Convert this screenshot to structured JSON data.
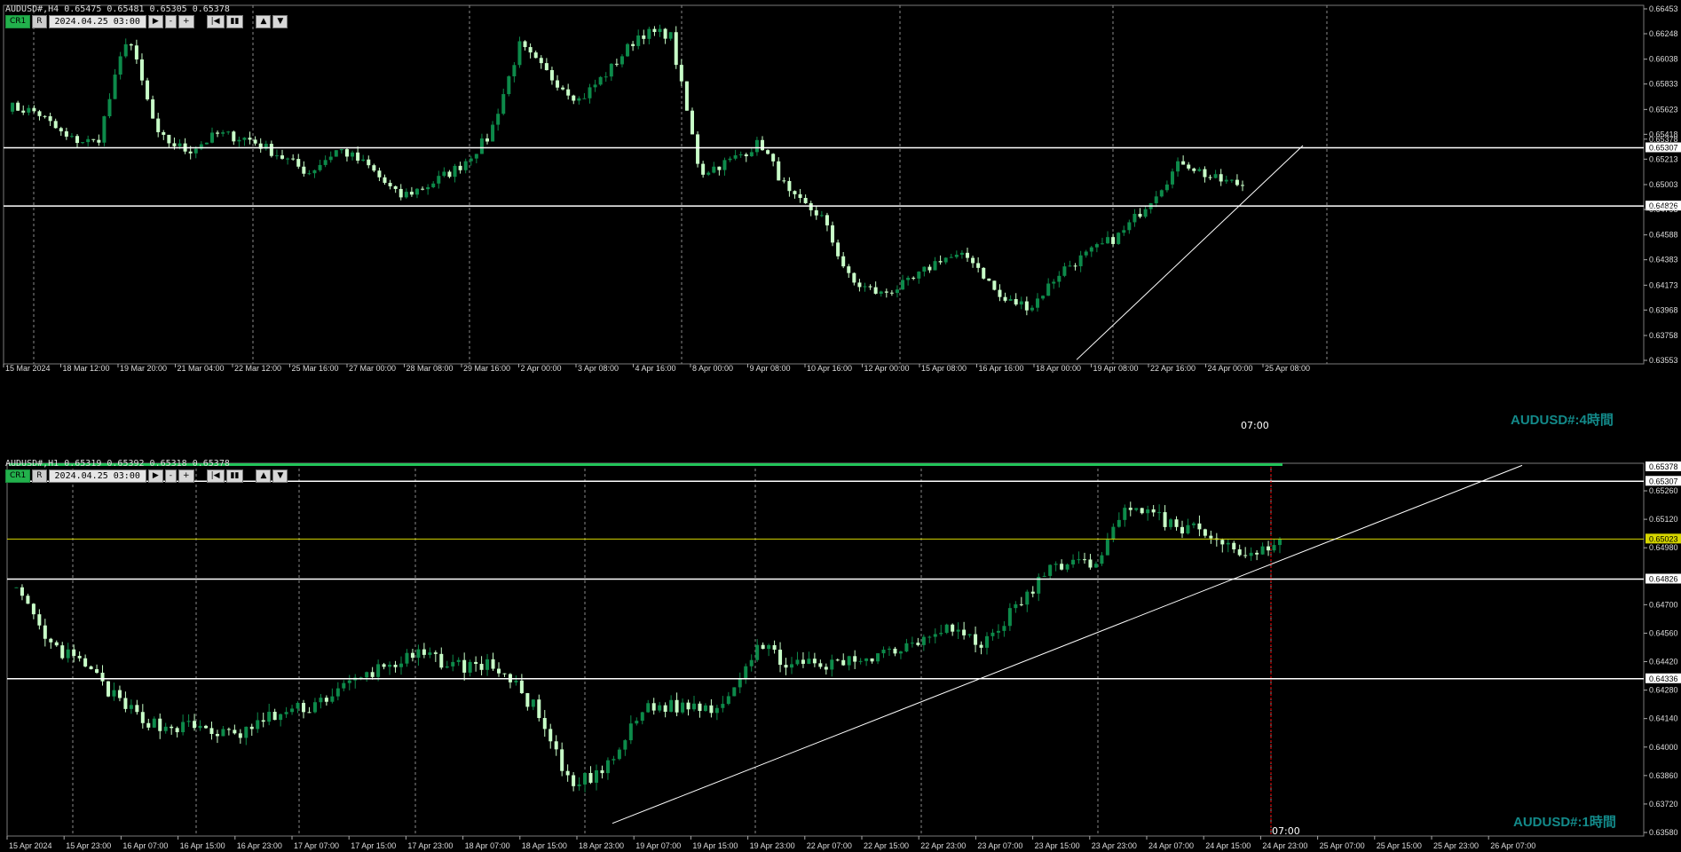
{
  "top_chart": {
    "symbol_info": "AUDUSD#,H4  0.65475 0.65481 0.65305 0.65378",
    "control_labels": [
      "CR1",
      "R"
    ],
    "date": "2024.04.25 03:00",
    "tag": "AUDUSD#:4時間",
    "time_label": "07:00",
    "price_labels": [
      "0.66453",
      "0.66248",
      "0.66038",
      "0.65833",
      "0.65623",
      "0.65418",
      "0.65378",
      "0.65307",
      "0.65213",
      "0.65003",
      "0.64826",
      "0.64798",
      "0.64588",
      "0.64383",
      "0.64173",
      "0.63968",
      "0.63758",
      "0.63553"
    ],
    "time_labels": [
      "15 Mar 2024",
      "18 Mar 12:00",
      "19 Mar 20:00",
      "21 Mar 04:00",
      "22 Mar 12:00",
      "25 Mar 16:00",
      "27 Mar 00:00",
      "28 Mar 08:00",
      "29 Mar 16:00",
      "2 Apr 00:00",
      "3 Apr 08:00",
      "4 Apr 16:00",
      "8 Apr 00:00",
      "9 Apr 08:00",
      "10 Apr 16:00",
      "12 Apr 00:00",
      "15 Apr 08:00",
      "16 Apr 16:00",
      "18 Apr 00:00",
      "19 Apr 08:00",
      "22 Apr 16:00",
      "24 Apr 00:00",
      "25 Apr 08:00"
    ],
    "hlines": [
      0.65307,
      0.64826
    ],
    "trendline": {
      "from_price": 0.63558,
      "to_price": 0.65325
    }
  },
  "bottom_chart": {
    "symbol_info": "AUDUSD#,H1  0.65319 0.65392 0.65318 0.65378",
    "control_labels": [
      "CR1",
      "R"
    ],
    "date": "2024.04.25 03:00",
    "tag": "AUDUSD#:1時間",
    "time_label": "07:00",
    "price_labels": [
      "0.65378",
      "0.65307",
      "0.65260",
      "0.65120",
      "0.65023",
      "0.64980",
      "0.64826",
      "0.64700",
      "0.64560",
      "0.64420",
      "0.64336",
      "0.64280",
      "0.64140",
      "0.64000",
      "0.63860",
      "0.63720",
      "0.63580"
    ],
    "time_labels": [
      "15 Apr 2024",
      "15 Apr 23:00",
      "16 Apr 07:00",
      "16 Apr 15:00",
      "16 Apr 23:00",
      "17 Apr 07:00",
      "17 Apr 15:00",
      "17 Apr 23:00",
      "18 Apr 07:00",
      "18 Apr 15:00",
      "18 Apr 23:00",
      "19 Apr 07:00",
      "19 Apr 15:00",
      "19 Apr 23:00",
      "22 Apr 07:00",
      "22 Apr 15:00",
      "22 Apr 23:00",
      "23 Apr 07:00",
      "23 Apr 15:00",
      "23 Apr 23:00",
      "24 Apr 07:00",
      "24 Apr 15:00",
      "24 Apr 23:00",
      "25 Apr 07:00",
      "25 Apr 15:00",
      "25 Apr 23:00",
      "26 Apr 07:00"
    ],
    "hlines": [
      0.65307,
      0.64826,
      0.64336
    ],
    "yellow_line": 0.65023,
    "trendline": {
      "from_price": 0.63625,
      "to_price": 0.65385
    }
  },
  "colors": {
    "bull": "#0d8a4a",
    "bear": "#c8ffc8",
    "grid": "#8a8a8a",
    "tag": "#138a8a",
    "yellow": "#d6d600",
    "vline": "#ff0000",
    "bid": "#22c45a"
  }
}
